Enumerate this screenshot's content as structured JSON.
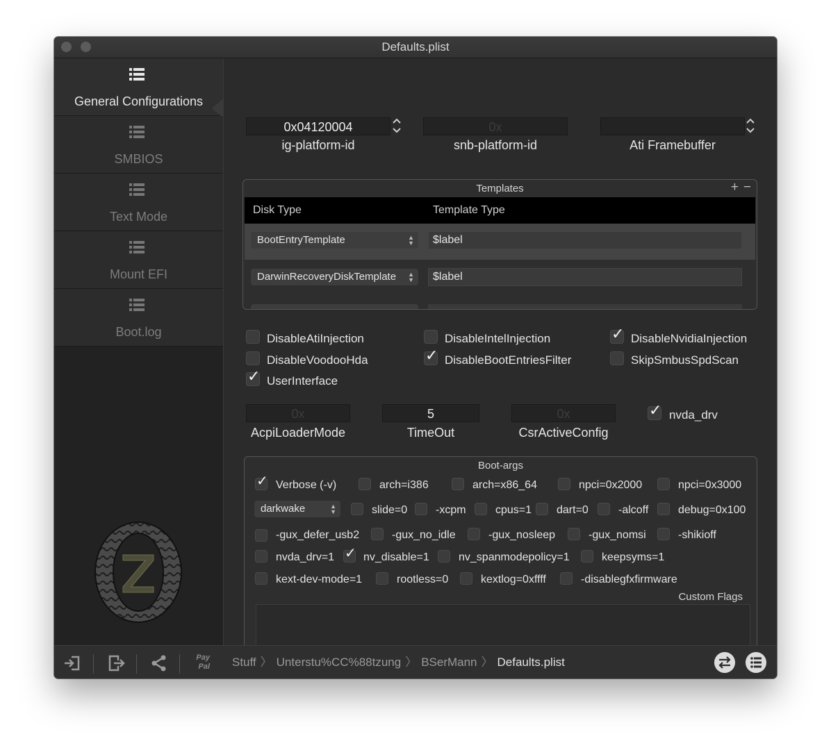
{
  "window": {
    "title": "Defaults.plist"
  },
  "sidebar": {
    "items": [
      {
        "label": "General Configurations",
        "icon": "list-icon",
        "active": true
      },
      {
        "label": "SMBIOS",
        "icon": "list-icon"
      },
      {
        "label": "Text Mode",
        "icon": "list-icon"
      },
      {
        "label": "Mount EFI",
        "icon": "list-icon"
      },
      {
        "label": "Boot.log",
        "icon": "list-icon"
      }
    ]
  },
  "graphics": {
    "ig_platform_id": {
      "value": "0x04120004",
      "label": "ig-platform-id"
    },
    "snb_platform_id": {
      "placeholder": "0x",
      "label": "snb-platform-id"
    },
    "ati_framebuffer": {
      "value": "",
      "label": "Ati Framebuffer"
    }
  },
  "templates": {
    "title": "Templates",
    "add": "+",
    "remove": "−",
    "columns": [
      "Disk Type",
      "Template Type"
    ],
    "rows": [
      {
        "disk_type": "BootEntryTemplate",
        "template_type": "$label"
      },
      {
        "disk_type": "DarwinRecoveryDiskTemplate",
        "template_type": "$label"
      }
    ]
  },
  "options": [
    {
      "label": "DisableAtiInjection",
      "checked": false
    },
    {
      "label": "DisableIntelInjection",
      "checked": false
    },
    {
      "label": "DisableNvidiaInjection",
      "checked": true
    },
    {
      "label": "DisableVoodooHda",
      "checked": false
    },
    {
      "label": "DisableBootEntriesFilter",
      "checked": true
    },
    {
      "label": "SkipSmbusSpdScan",
      "checked": false
    },
    {
      "label": "UserInterface",
      "checked": true
    }
  ],
  "acpi": {
    "acpi_loader_mode": {
      "placeholder": "0x",
      "label": "AcpiLoaderMode"
    },
    "timeout": {
      "value": "5",
      "label": "TimeOut"
    },
    "csr_active_config": {
      "placeholder": "0x",
      "label": "CsrActiveConfig"
    },
    "nvda_drv": {
      "label": "nvda_drv",
      "checked": true
    }
  },
  "boot_args": {
    "title": "Boot-args",
    "darkwake": "darkwake",
    "flags": [
      {
        "label": "Verbose (-v)",
        "checked": true
      },
      {
        "label": "arch=i386",
        "checked": false
      },
      {
        "label": "arch=x86_64",
        "checked": false
      },
      {
        "label": "npci=0x2000",
        "checked": false
      },
      {
        "label": "npci=0x3000",
        "checked": false
      },
      {
        "label": "slide=0",
        "checked": false
      },
      {
        "label": "-xcpm",
        "checked": false
      },
      {
        "label": "cpus=1",
        "checked": false
      },
      {
        "label": "dart=0",
        "checked": false
      },
      {
        "label": "-alcoff",
        "checked": false
      },
      {
        "label": "debug=0x100",
        "checked": false
      },
      {
        "label": "-gux_defer_usb2",
        "checked": false
      },
      {
        "label": "-gux_no_idle",
        "checked": false
      },
      {
        "label": "-gux_nosleep",
        "checked": false
      },
      {
        "label": "-gux_nomsi",
        "checked": false
      },
      {
        "label": "-shikioff",
        "checked": false
      },
      {
        "label": "nvda_drv=1",
        "checked": false
      },
      {
        "label": "nv_disable=1",
        "checked": true
      },
      {
        "label": "nv_spanmodepolicy=1",
        "checked": false
      },
      {
        "label": "keepsyms=1",
        "checked": false
      },
      {
        "label": "kext-dev-mode=1",
        "checked": false
      },
      {
        "label": "rootless=0",
        "checked": false
      },
      {
        "label": "kextlog=0xffff",
        "checked": false
      },
      {
        "label": "-disablegfxfirmware",
        "checked": false
      }
    ],
    "custom_flags_label": "Custom Flags",
    "custom_flags_value": ""
  },
  "bottombar": {
    "paypal": "Pay Pal",
    "breadcrumb": [
      "Stuff",
      "Unterstu%CC%88tzung",
      "BSerMann",
      "Defaults.plist"
    ]
  }
}
